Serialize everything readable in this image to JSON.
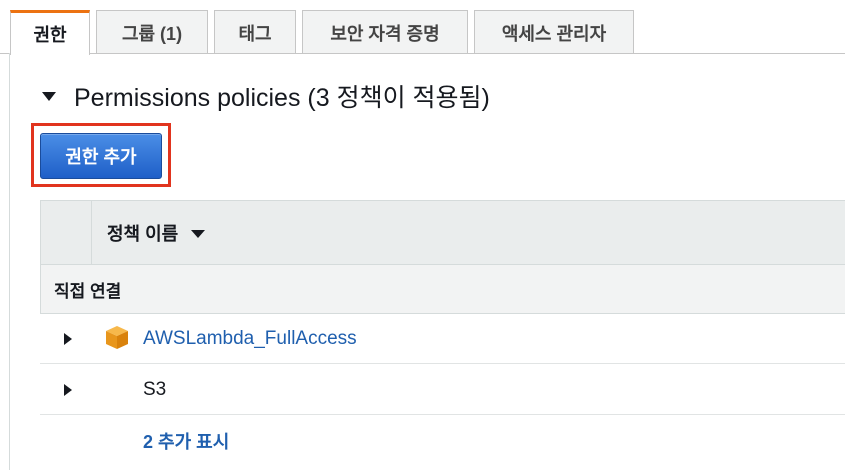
{
  "tabs": [
    {
      "label": "권한",
      "active": true
    },
    {
      "label": "그룹 (1)",
      "active": false
    },
    {
      "label": "태그",
      "active": false
    },
    {
      "label": "보안 자격 증명",
      "active": false
    },
    {
      "label": "액세스 관리자",
      "active": false
    }
  ],
  "section": {
    "title": "Permissions policies (3 정책이 적용됨)",
    "add_button_label": "권한 추가"
  },
  "table": {
    "column_header": "정책 이름",
    "group_label": "직접 연결",
    "rows": [
      {
        "name": "AWSLambda_FullAccess",
        "icon": "aws-managed-policy-cube-icon",
        "link": true
      },
      {
        "name": "S3",
        "link": false
      }
    ],
    "show_more": "2 추가 표시"
  },
  "colors": {
    "accent_tab": "#ec7211",
    "primary_button": "#2e72d2",
    "link": "#1f5fae",
    "highlight": "#e1341e"
  }
}
